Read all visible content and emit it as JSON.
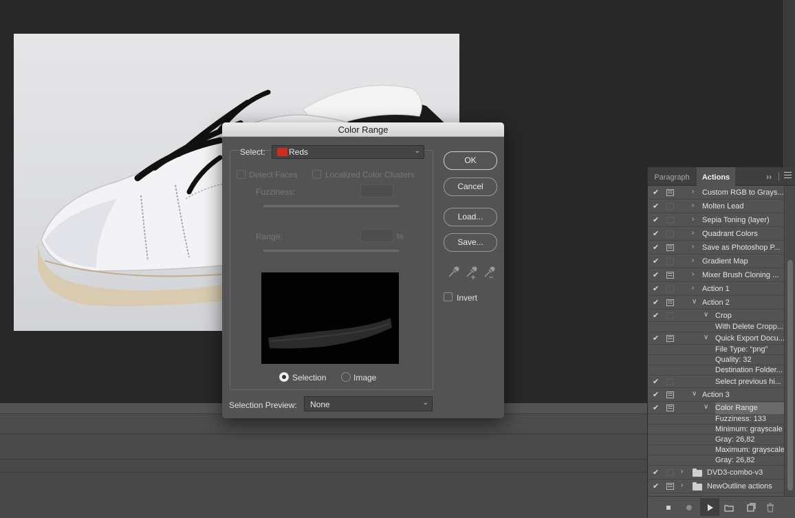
{
  "dialog": {
    "title": "Color Range",
    "select_label": "Select:",
    "select_value": "Reds",
    "select_swatch_color": "#d12a1e",
    "detect_faces_label": "Detect Faces",
    "localized_clusters_label": "Localized Color Clusters",
    "fuzziness_label": "Fuzziness:",
    "range_label": "Range:",
    "range_unit": "%",
    "radio_selection_label": "Selection",
    "radio_image_label": "Image",
    "radio_selected": "Selection",
    "buttons": {
      "ok": "OK",
      "cancel": "Cancel",
      "load": "Load...",
      "save": "Save..."
    },
    "invert_label": "Invert",
    "invert_checked": false,
    "selection_preview_label": "Selection Preview:",
    "selection_preview_value": "None"
  },
  "panel": {
    "tabs": [
      {
        "label": "Paragraph",
        "active": false
      },
      {
        "label": "Actions",
        "active": true
      }
    ],
    "collapse_icon": "double-chevron-right-icon",
    "menu_icon": "hamburger-menu-icon"
  },
  "actions": [
    {
      "label": "Custom RGB to Grays...",
      "check": true,
      "dialog": "on",
      "toggle": "right",
      "level": 0,
      "kind": "action"
    },
    {
      "label": "Molten Lead",
      "check": true,
      "dialog": "off",
      "toggle": "right",
      "level": 0,
      "kind": "action"
    },
    {
      "label": "Sepia Toning (layer)",
      "check": true,
      "dialog": "off",
      "toggle": "right",
      "level": 0,
      "kind": "action"
    },
    {
      "label": "Quadrant Colors",
      "check": true,
      "dialog": "off",
      "toggle": "right",
      "level": 0,
      "kind": "action"
    },
    {
      "label": "Save as Photoshop P...",
      "check": true,
      "dialog": "on",
      "toggle": "right",
      "level": 0,
      "kind": "action"
    },
    {
      "label": "Gradient Map",
      "check": true,
      "dialog": "off",
      "toggle": "right",
      "level": 0,
      "kind": "action"
    },
    {
      "label": "Mixer Brush Cloning ...",
      "check": true,
      "dialog": "on",
      "toggle": "right",
      "level": 0,
      "kind": "action"
    },
    {
      "label": "Action 1",
      "check": true,
      "dialog": "off",
      "toggle": "right",
      "level": 0,
      "kind": "action"
    },
    {
      "label": "Action 2",
      "check": true,
      "dialog": "on",
      "toggle": "down",
      "level": 0,
      "kind": "action"
    },
    {
      "label": "Crop",
      "check": true,
      "dialog": "off",
      "toggle": "down",
      "level": 1,
      "kind": "step"
    },
    {
      "label": "With Delete Cropp...",
      "check": false,
      "dialog": "none",
      "toggle": "none",
      "level": 2,
      "kind": "detail"
    },
    {
      "label": "Quick Export Docu...",
      "check": true,
      "dialog": "on",
      "toggle": "down",
      "level": 1,
      "kind": "step"
    },
    {
      "label": "File Type:  “png”",
      "check": false,
      "dialog": "none",
      "toggle": "none",
      "level": 2,
      "kind": "detail"
    },
    {
      "label": "Quality: 32",
      "check": false,
      "dialog": "none",
      "toggle": "none",
      "level": 2,
      "kind": "detail"
    },
    {
      "label": "Destination Folder...",
      "check": false,
      "dialog": "none",
      "toggle": "none",
      "level": 2,
      "kind": "detail"
    },
    {
      "label": "Select previous hi...",
      "check": true,
      "dialog": "off",
      "toggle": "none",
      "level": 1,
      "kind": "step"
    },
    {
      "label": "Action 3",
      "check": true,
      "dialog": "on",
      "toggle": "down",
      "level": 0,
      "kind": "action"
    },
    {
      "label": "Color Range",
      "check": true,
      "dialog": "on",
      "toggle": "down",
      "level": 1,
      "kind": "step",
      "highlight": true
    },
    {
      "label": "Fuzziness: 133",
      "check": false,
      "dialog": "none",
      "toggle": "none",
      "level": 2,
      "kind": "detail"
    },
    {
      "label": "Minimum: grayscale",
      "check": false,
      "dialog": "none",
      "toggle": "none",
      "level": 2,
      "kind": "detail"
    },
    {
      "label": "Gray: 26,82",
      "check": false,
      "dialog": "none",
      "toggle": "none",
      "level": 2,
      "kind": "detail"
    },
    {
      "label": "Maximum: grayscale",
      "check": false,
      "dialog": "none",
      "toggle": "none",
      "level": 2,
      "kind": "detail"
    },
    {
      "label": "Gray: 26,82",
      "check": false,
      "dialog": "none",
      "toggle": "none",
      "level": 2,
      "kind": "detail"
    },
    {
      "label": "DVD3-combo-v3",
      "check": true,
      "dialog": "off",
      "toggle": "right",
      "level": 0,
      "kind": "set"
    },
    {
      "label": "NewOutline actions",
      "check": true,
      "dialog": "on",
      "toggle": "right",
      "level": 0,
      "kind": "set"
    }
  ],
  "footer_icons": [
    "stop-icon",
    "record-icon",
    "play-icon",
    "new-set-folder-icon",
    "new-action-icon",
    "trash-icon"
  ]
}
